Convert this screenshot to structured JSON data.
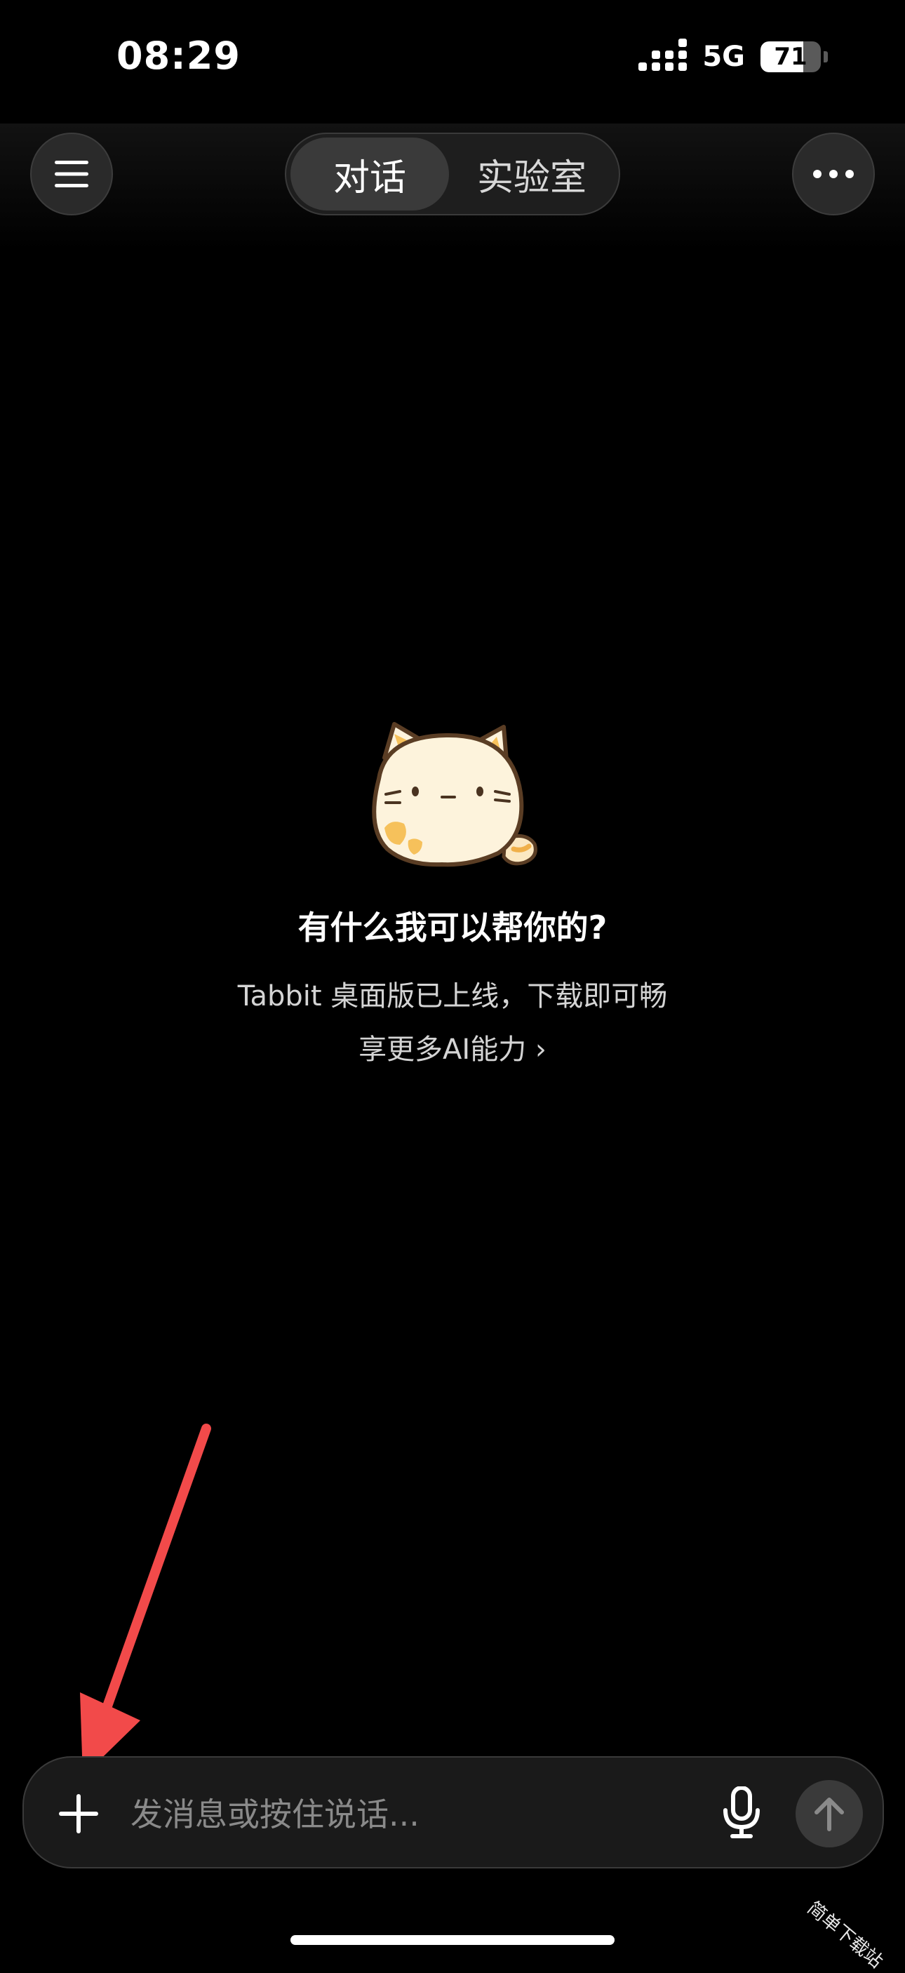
{
  "status_bar": {
    "time": "08:29",
    "network": "5G",
    "battery_percent": "71",
    "battery_level": 0.71
  },
  "header": {
    "menu_icon": "hamburger-menu-icon",
    "more_icon": "more-dots-icon",
    "tabs": [
      {
        "label": "对话",
        "active": true
      },
      {
        "label": "实验室",
        "active": false
      }
    ]
  },
  "main": {
    "mascot_icon": "cat-mascot-icon",
    "headline": "有什么我可以帮你的?",
    "promo_line1": "Tabbit 桌面版已上线，下载即可畅",
    "promo_line2": "享更多AI能力 ›"
  },
  "composer": {
    "plus_icon": "plus-icon",
    "placeholder": "发消息或按住说话...",
    "mic_icon": "microphone-icon",
    "send_icon": "arrow-up-icon"
  },
  "annotation": {
    "arrow_color": "#f24a4a"
  },
  "watermark": "简单下载站",
  "colors": {
    "background": "#000000",
    "button_bg": "#2a2a2a",
    "input_bg": "#1a1a1a"
  }
}
